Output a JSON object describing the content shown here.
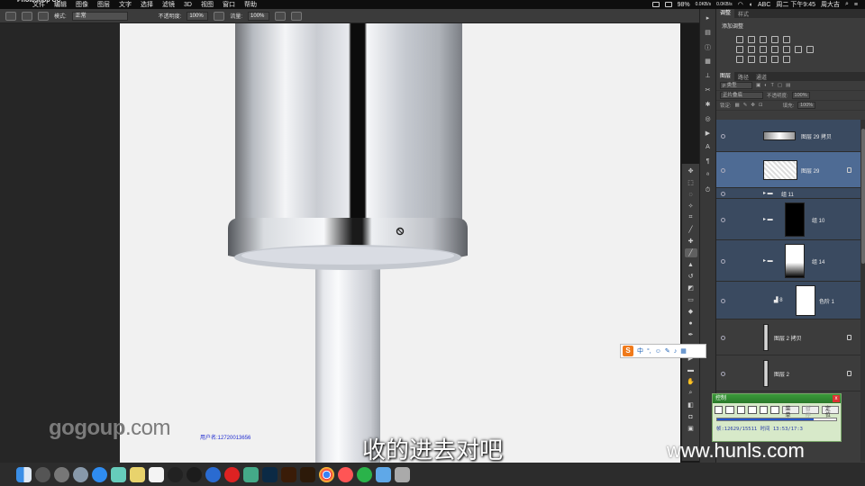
{
  "menubar": {
    "app_name": "Photoshop CC",
    "items": [
      "文件",
      "编辑",
      "图像",
      "图层",
      "文字",
      "选择",
      "滤镜",
      "3D",
      "视图",
      "窗口",
      "帮助"
    ],
    "battery": "98%",
    "net_up": "0.0KB/s",
    "net_down": "0.0KB/s",
    "input_source": "ABC",
    "clock": "周二 下午9:45",
    "user": "周大吉"
  },
  "options_bar": {
    "mode_label": "模式:",
    "mode_value": "正常",
    "opacity_label": "不透明度:",
    "opacity_value": "100%",
    "flow_label": "流量:",
    "flow_value": "100%"
  },
  "panels": {
    "top_tabs": [
      "调整",
      "样式"
    ],
    "adjust_title": "添加调整",
    "layer_tabs": [
      "图层",
      "路径",
      "通道"
    ],
    "filter_kind": "ρ 类型",
    "blend_mode": "正片叠底",
    "opacity_label": "不透明度:",
    "opacity_value": "100%",
    "lock_label": "锁定:",
    "fill_label": "填充:",
    "fill_value": "100%"
  },
  "layers": [
    {
      "name": "图层 29 拷贝",
      "style": "blue"
    },
    {
      "name": "图层 29",
      "style": "sel"
    },
    {
      "name": "组 11",
      "style": "blue"
    },
    {
      "name": "组 10",
      "style": "blue"
    },
    {
      "name": "组 14",
      "style": "blue"
    },
    {
      "name": "色阶 1",
      "style": "blue"
    },
    {
      "name": "图层 2 拷贝",
      "style": "plain"
    },
    {
      "name": "图层 2",
      "style": "plain"
    }
  ],
  "ime": {
    "items": [
      "中",
      "°,",
      "☺",
      "✎",
      "♪",
      "▦"
    ]
  },
  "player": {
    "title": "控制",
    "close": "x",
    "menu_label": "菜单",
    "pause_label": "暂停",
    "locate_label": "定位",
    "progress_fraction": 0.81,
    "info": "帧:12629/15511 时间 13:53/17:3"
  },
  "watermarks": {
    "left_brand": "gogoup",
    "left_tld": ".com",
    "user_id": "用户名:12720013656",
    "right": "www.hunls.com"
  },
  "subtitle": "收的进去对吧",
  "dock_apps": [
    "finder",
    "launchpad",
    "calendar",
    "photoshop",
    "illustrator",
    "bridge",
    "chrome",
    "music",
    "wechat",
    "trash"
  ],
  "colors": {
    "layer_blue": "#3a4a60",
    "layer_selected": "#4e6b94",
    "subtitle": "#ffffff",
    "user_id": "#1f2bd0"
  }
}
